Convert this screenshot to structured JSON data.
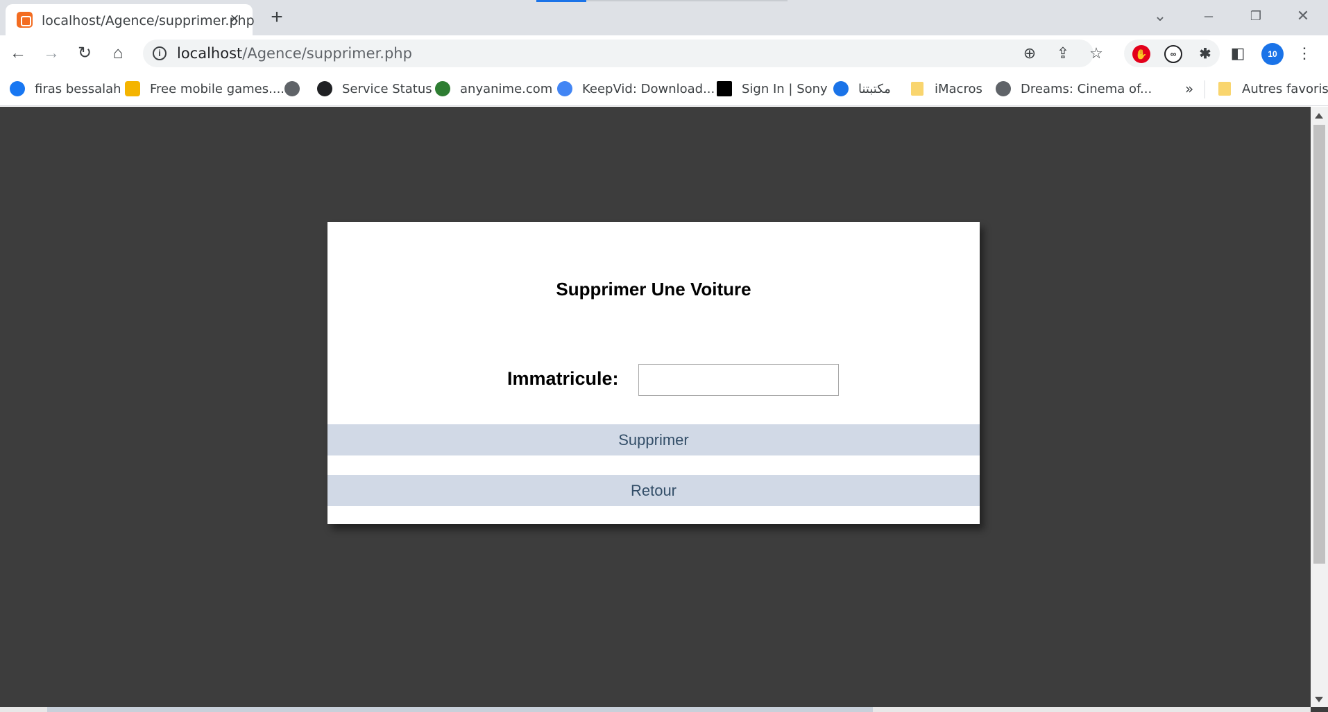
{
  "browser": {
    "tab_title": "localhost/Agence/supprimer.php",
    "tab_close": "×",
    "new_tab": "+",
    "url_host": "localhost",
    "url_path": "/Agence/supprimer.php",
    "profile_badge": "10",
    "bookmarks": [
      {
        "label": "firas bessalah",
        "icon": "meta-icon",
        "color": "#1877f2"
      },
      {
        "label": "Free mobile games....",
        "icon": "game-icon",
        "color": "#f4b400"
      },
      {
        "label": "",
        "icon": "globe-icon",
        "color": "#5f6368"
      },
      {
        "label": "Service Status",
        "icon": "status-icon",
        "color": "#202124"
      },
      {
        "label": "anyanime.com",
        "icon": "anime-icon",
        "color": "#2e7d32"
      },
      {
        "label": "KeepVid: Download...",
        "icon": "keepvid-icon",
        "color": "#4285f4"
      },
      {
        "label": "Sign In | Sony",
        "icon": "sony-icon",
        "color": "#000000"
      },
      {
        "label": "مكتبتنا",
        "icon": "r-icon",
        "color": "#1a73e8"
      },
      {
        "label": "iMacros",
        "icon": "folder-icon",
        "color": "#f9d56e"
      },
      {
        "label": "Dreams: Cinema of...",
        "icon": "globe-icon",
        "color": "#5f6368"
      }
    ],
    "more_bookmarks": "»",
    "other_bookmarks": "Autres favoris"
  },
  "page": {
    "title": "Supprimer Une Voiture",
    "immatricule_label": "Immatricule:",
    "immatricule_value": "",
    "delete_button": "Supprimer",
    "back_button": "Retour"
  },
  "colors": {
    "page_background": "#3d3d3d",
    "button_background": "#d1d9e6",
    "button_text": "#334e68"
  }
}
